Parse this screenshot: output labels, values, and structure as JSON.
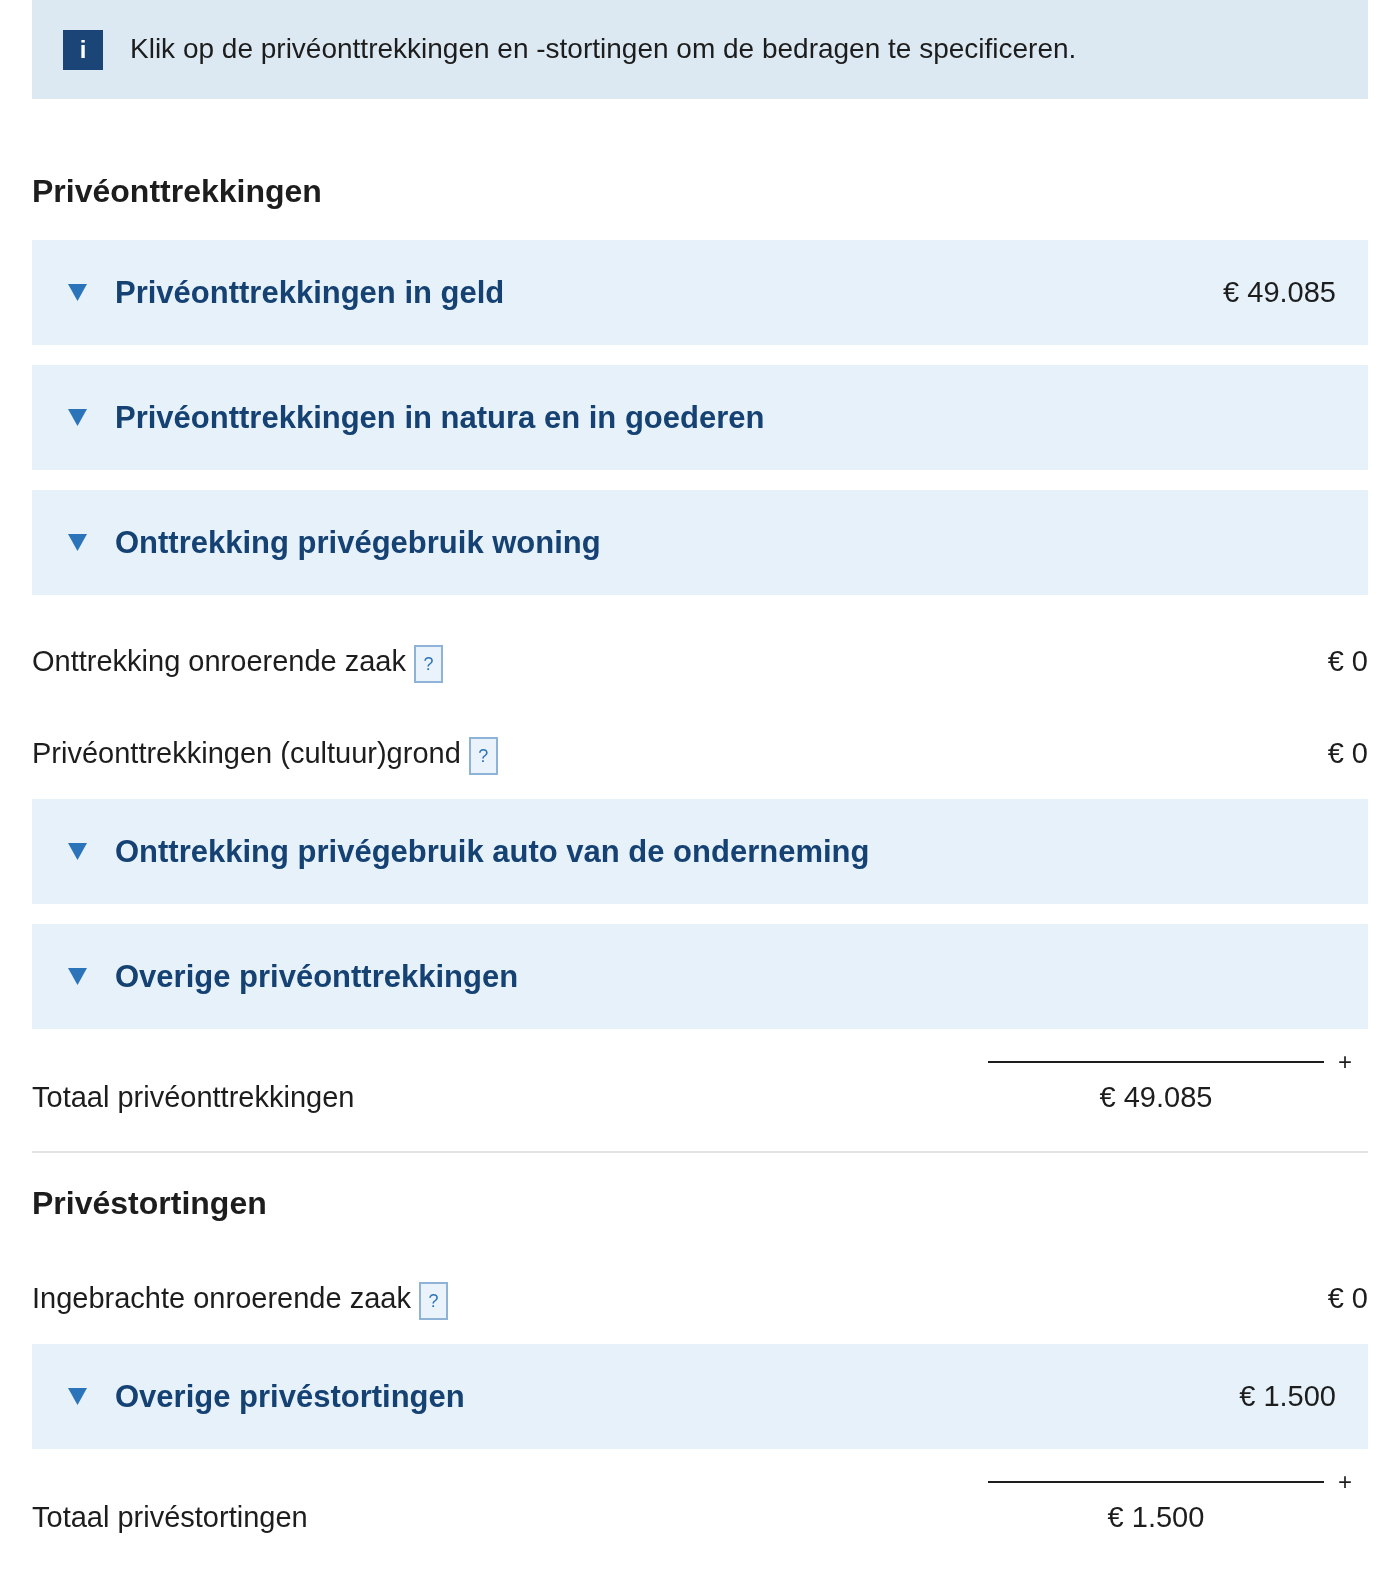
{
  "info_banner": {
    "icon": "i",
    "text": "Klik op de privéonttrekkingen en -stortingen om de bedragen te specificeren."
  },
  "sections": [
    {
      "title": "Privéonttrekkingen",
      "items": [
        {
          "kind": "accordion",
          "label": "Privéonttrekkingen in geld",
          "amount": "€ 49.085"
        },
        {
          "kind": "accordion",
          "label": "Privéonttrekkingen in natura en in goederen"
        },
        {
          "kind": "accordion",
          "label": "Onttrekking privégebruik woning"
        },
        {
          "kind": "field",
          "label": "Onttrekking onroerende zaak",
          "help": "?",
          "amount": "€ 0"
        },
        {
          "kind": "field",
          "label": "Privéonttrekkingen (cultuur)grond",
          "help": "?",
          "amount": "€ 0"
        },
        {
          "kind": "accordion",
          "label": "Onttrekking privégebruik auto van de onderneming"
        },
        {
          "kind": "accordion",
          "label": "Overige privéonttrekkingen"
        },
        {
          "kind": "total",
          "label": "Totaal privéonttrekkingen",
          "operator": "+",
          "amount": "€ 49.085"
        }
      ]
    },
    {
      "title": "Privéstortingen",
      "items": [
        {
          "kind": "field",
          "label": "Ingebrachte onroerende zaak",
          "help": "?",
          "amount": "€ 0"
        },
        {
          "kind": "accordion",
          "label": "Overige privéstortingen",
          "amount": "€ 1.500"
        },
        {
          "kind": "total",
          "label": "Totaal privéstortingen",
          "operator": "+",
          "amount": "€ 1.500"
        }
      ]
    }
  ]
}
